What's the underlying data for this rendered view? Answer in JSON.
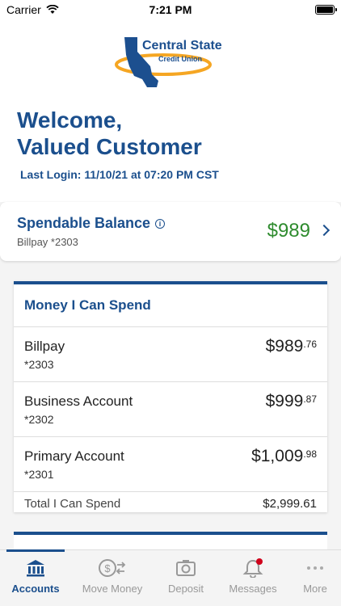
{
  "status": {
    "carrier": "Carrier",
    "time": "7:21 PM"
  },
  "logo": {
    "name": "Central State",
    "sub": "Credit Union"
  },
  "welcome": {
    "line1": "Welcome,",
    "line2": "Valued Customer"
  },
  "last_login": "Last Login: 11/10/21 at 07:20 PM CST",
  "spendable": {
    "title": "Spendable Balance",
    "account": "Billpay *2303",
    "amount": "$989"
  },
  "money_card": {
    "title": "Money I Can Spend",
    "accounts": [
      {
        "name": "Billpay",
        "number": "*2303",
        "amount": "$989",
        "cents": ".76"
      },
      {
        "name": "Business Account",
        "number": "*2302",
        "amount": "$999",
        "cents": ".87"
      },
      {
        "name": "Primary Account",
        "number": "*2301",
        "amount": "$1,009",
        "cents": ".98"
      }
    ],
    "total_label": "Total I Can Spend",
    "total_amount": "$2,999.61"
  },
  "tabs": [
    {
      "label": "Accounts",
      "icon": "bank-icon",
      "active": true
    },
    {
      "label": "Move Money",
      "icon": "money-transfer-icon",
      "active": false
    },
    {
      "label": "Deposit",
      "icon": "camera-icon",
      "active": false
    },
    {
      "label": "Messages",
      "icon": "bell-icon",
      "active": false
    },
    {
      "label": "More",
      "icon": "more-dots-icon",
      "active": false
    }
  ],
  "colors": {
    "brand": "#1b4f8d",
    "positive": "#2e8b2e",
    "accent_logo": "#f5a623",
    "badge": "#d0021b"
  }
}
